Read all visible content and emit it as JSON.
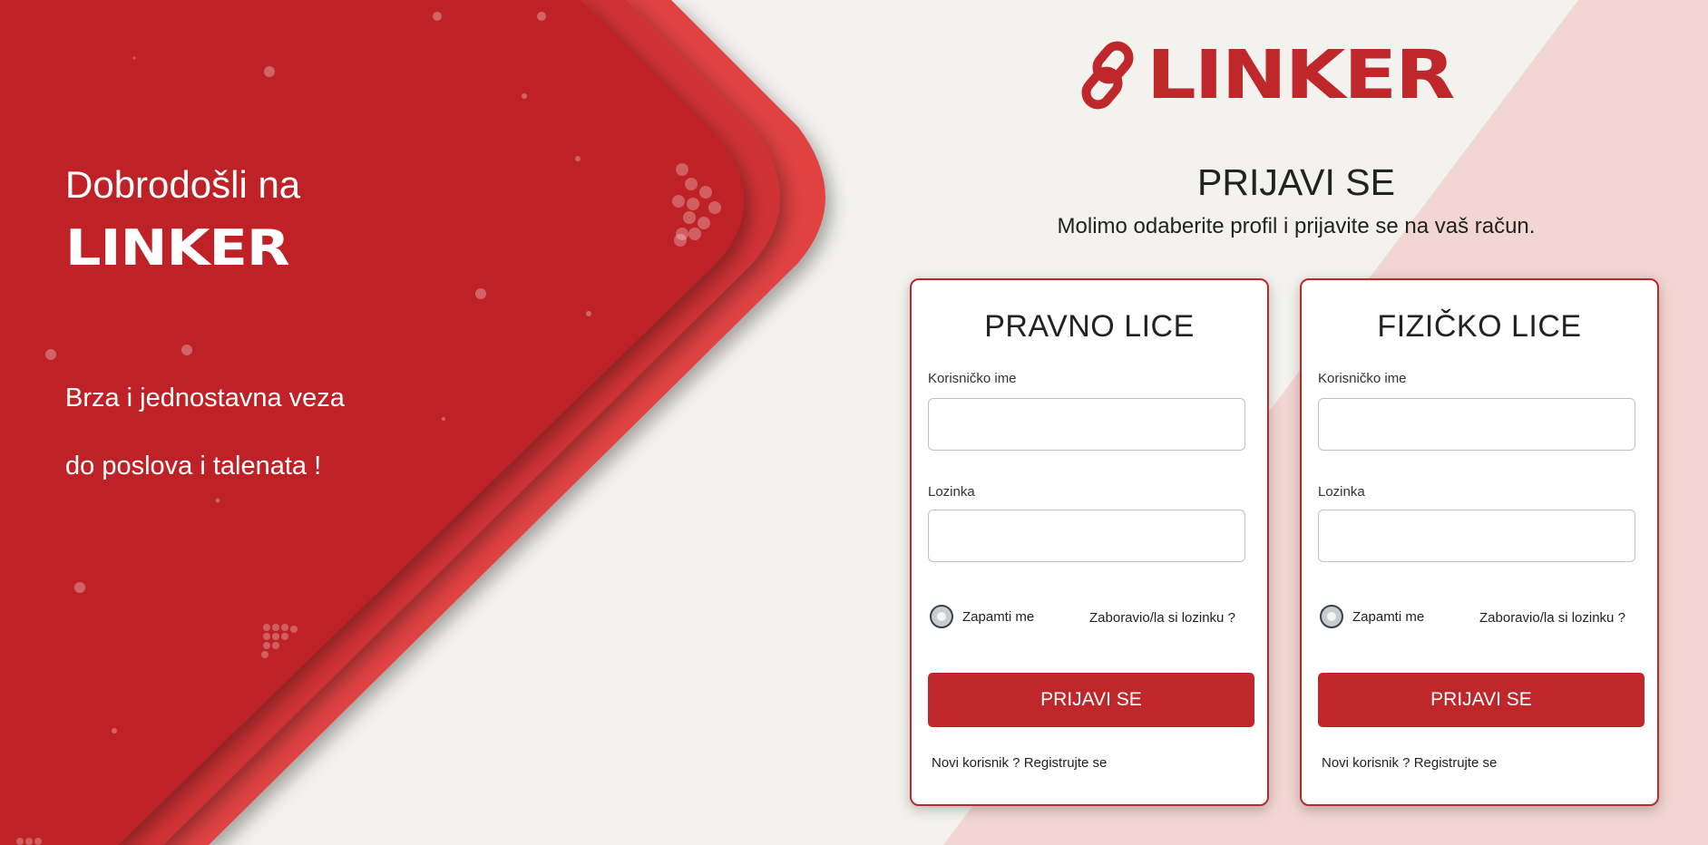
{
  "hero": {
    "welcome": "Dobrodošli na",
    "logo_text": "LINKER",
    "tagline_line1": "Brza i jednostavna veza",
    "tagline_line2": "do poslova i talenata !"
  },
  "brand": {
    "logo_text": "LINKER",
    "icon": "chain-link-icon"
  },
  "page": {
    "title": "PRIJAVI SE",
    "subtitle": "Molimo odaberite profil i prijavite se na vaš račun."
  },
  "cards": [
    {
      "title": "PRAVNO LICE",
      "username_label": "Korisničko ime",
      "username_value": "",
      "password_label": "Lozinka",
      "password_value": "",
      "remember_label": "Zapamti me",
      "forgot_label": "Zaboravio/la si lozinku ?",
      "login_label": "PRIJAVI SE",
      "register_label": "Novi korisnik ? Registrujte se"
    },
    {
      "title": "FIZIČKO LICE",
      "username_label": "Korisničko ime",
      "username_value": "",
      "password_label": "Lozinka",
      "password_value": "",
      "remember_label": "Zapamti me",
      "forgot_label": "Zaboravio/la si lozinku ?",
      "login_label": "PRIJAVI SE",
      "register_label": "Novi korisnik ? Registrujte se"
    }
  ],
  "colors": {
    "brand_red": "#c0272b",
    "light_red": "#e04040",
    "background": "#f3f2ee",
    "pink_panel": "#f2d6d2"
  }
}
